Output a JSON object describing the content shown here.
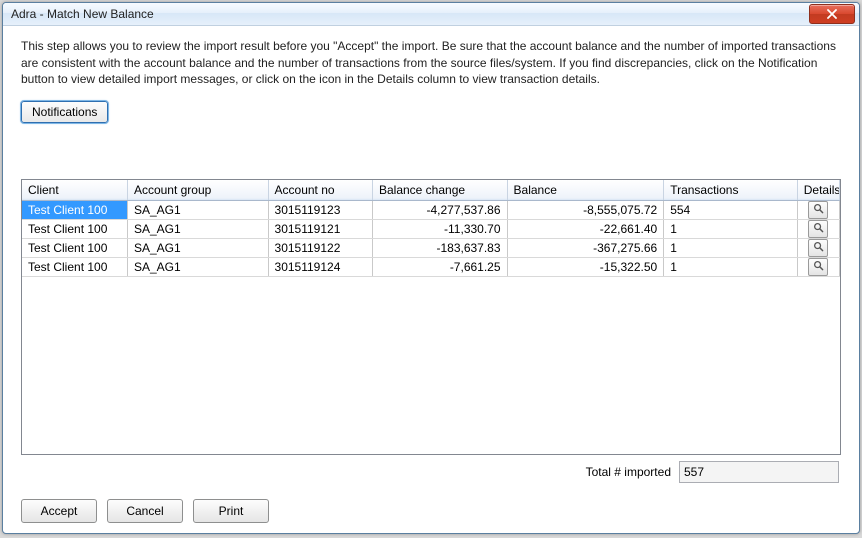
{
  "window": {
    "title": "Adra - Match New Balance"
  },
  "instructions": "This step allows you to review the import result before you \"Accept\" the import. Be sure that the account balance and the number of imported transactions are consistent with the account balance and the number of transactions from the source files/system. If you find discrepancies, click on the Notification button to view detailed import messages, or click on the icon in the Details column to view transaction details.",
  "buttons": {
    "notifications": "Notifications",
    "accept": "Accept",
    "cancel": "Cancel",
    "print": "Print"
  },
  "table": {
    "headers": {
      "client": "Client",
      "group": "Account group",
      "acct": "Account no",
      "bchg": "Balance change",
      "bal": "Balance",
      "trn": "Transactions",
      "det": "Details"
    },
    "rows": [
      {
        "client": "Test Client 100",
        "group": "SA_AG1",
        "acct": "3015119123",
        "bchg": "-4,277,537.86",
        "bal": "-8,555,075.72",
        "trn": "554",
        "selected": true
      },
      {
        "client": "Test Client 100",
        "group": "SA_AG1",
        "acct": "3015119121",
        "bchg": "-11,330.70",
        "bal": "-22,661.40",
        "trn": "1",
        "selected": false
      },
      {
        "client": "Test Client 100",
        "group": "SA_AG1",
        "acct": "3015119122",
        "bchg": "-183,637.83",
        "bal": "-367,275.66",
        "trn": "1",
        "selected": false
      },
      {
        "client": "Test Client 100",
        "group": "SA_AG1",
        "acct": "3015119124",
        "bchg": "-7,661.25",
        "bal": "-15,322.50",
        "trn": "1",
        "selected": false
      }
    ]
  },
  "footer": {
    "label": "Total # imported",
    "value": "557"
  }
}
